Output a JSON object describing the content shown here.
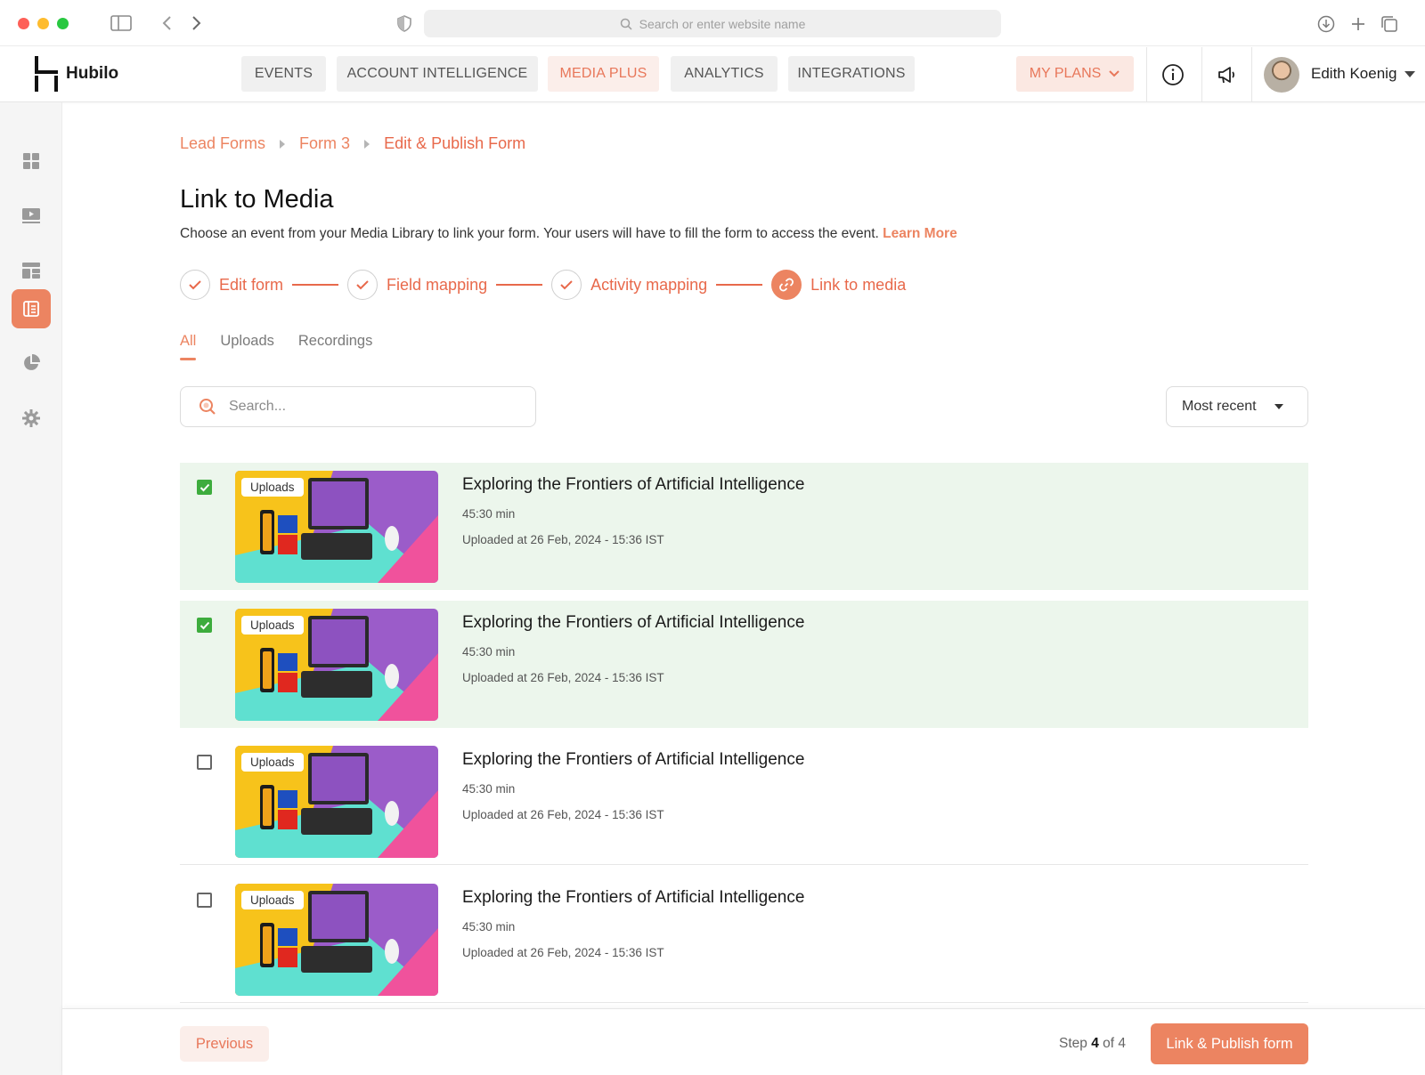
{
  "browser": {
    "url_placeholder": "Search or enter website name"
  },
  "header": {
    "logo_text": "Hubilo",
    "nav": [
      {
        "label": "EVENTS",
        "active": false
      },
      {
        "label": "ACCOUNT INTELLIGENCE",
        "active": false
      },
      {
        "label": "MEDIA PLUS",
        "active": true
      },
      {
        "label": "ANALYTICS",
        "active": false
      },
      {
        "label": "INTEGRATIONS",
        "active": false
      }
    ],
    "my_plans": "MY PLANS",
    "user_name": "Edith Koenig"
  },
  "sidebar": {
    "items": [
      {
        "icon": "dashboard-grid-icon",
        "active": false
      },
      {
        "icon": "video-play-icon",
        "active": false
      },
      {
        "icon": "layout-icon",
        "active": false
      },
      {
        "icon": "form-icon",
        "active": true
      },
      {
        "icon": "pie-chart-icon",
        "active": false
      },
      {
        "icon": "settings-gear-icon",
        "active": false
      }
    ]
  },
  "breadcrumb": [
    "Lead Forms",
    "Form 3",
    "Edit & Publish Form"
  ],
  "page": {
    "title": "Link to Media",
    "description": "Choose an event from your Media Library to link your form. Your users will have to fill the form to access the event.",
    "learn_more": "Learn More"
  },
  "stepper": [
    {
      "label": "Edit form",
      "state": "done"
    },
    {
      "label": "Field mapping",
      "state": "done"
    },
    {
      "label": "Activity mapping",
      "state": "done"
    },
    {
      "label": "Link to media",
      "state": "current"
    }
  ],
  "tabs": [
    {
      "label": "All",
      "active": true
    },
    {
      "label": "Uploads",
      "active": false
    },
    {
      "label": "Recordings",
      "active": false
    }
  ],
  "search": {
    "placeholder": "Search..."
  },
  "sort": {
    "selected": "Most recent"
  },
  "media_items": [
    {
      "badge": "Uploads",
      "title": "Exploring the Frontiers of Artificial Intelligence",
      "duration": "45:30 min",
      "uploaded": "Uploaded at 26 Feb, 2024 - 15:36 IST",
      "checked": true
    },
    {
      "badge": "Uploads",
      "title": "Exploring the Frontiers of Artificial Intelligence",
      "duration": "45:30 min",
      "uploaded": "Uploaded at 26 Feb, 2024 - 15:36 IST",
      "checked": true
    },
    {
      "badge": "Uploads",
      "title": "Exploring the Frontiers of Artificial Intelligence",
      "duration": "45:30 min",
      "uploaded": "Uploaded at 26 Feb, 2024 - 15:36 IST",
      "checked": false
    },
    {
      "badge": "Uploads",
      "title": "Exploring the Frontiers of Artificial Intelligence",
      "duration": "45:30 min",
      "uploaded": "Uploaded at 26 Feb, 2024 - 15:36 IST",
      "checked": false
    }
  ],
  "footer": {
    "previous": "Previous",
    "step_prefix": "Step",
    "step_current": "4",
    "step_of": "of 4",
    "publish": "Link & Publish form"
  },
  "colors": {
    "accent": "#ec8461",
    "accent_text": "#e8694b",
    "selected_row": "#ecf6ec",
    "checkbox_checked": "#3dac3d"
  }
}
